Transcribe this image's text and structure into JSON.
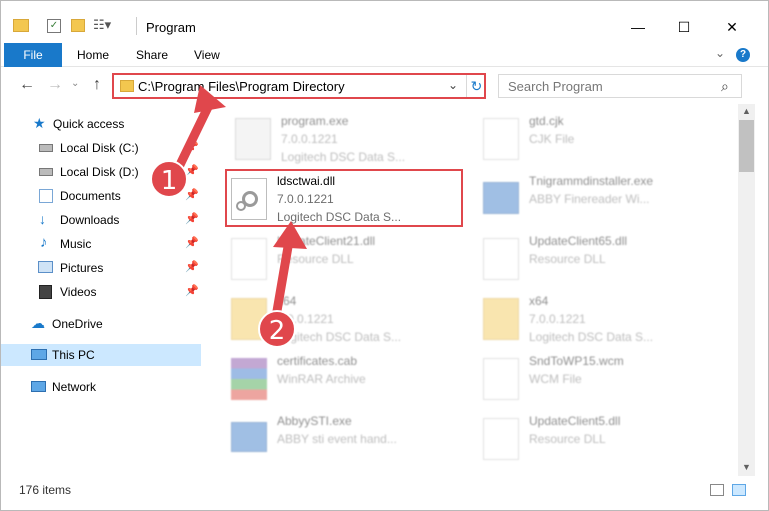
{
  "window": {
    "title": "Program",
    "minimize_glyph": "—",
    "maximize_glyph": "☐",
    "close_glyph": "✕"
  },
  "ribbon": {
    "tabs": [
      "File",
      "Home",
      "Share",
      "View"
    ],
    "help_glyph": "?"
  },
  "address": {
    "path": "C:\\Program Files\\Program Directory",
    "search_placeholder": "Search Program"
  },
  "nav": {
    "items": [
      {
        "label": "Quick access",
        "icon": "star-icon",
        "pinned": false
      },
      {
        "label": "Local Disk (C:)",
        "icon": "drive-icon",
        "pinned": true
      },
      {
        "label": "Local Disk (D:)",
        "icon": "drive-icon",
        "pinned": true
      },
      {
        "label": "Documents",
        "icon": "documents-icon",
        "pinned": true
      },
      {
        "label": "Downloads",
        "icon": "download-icon",
        "pinned": true
      },
      {
        "label": "Music",
        "icon": "music-icon",
        "pinned": true
      },
      {
        "label": "Pictures",
        "icon": "pictures-icon",
        "pinned": true
      },
      {
        "label": "Videos",
        "icon": "videos-icon",
        "pinned": true
      },
      {
        "label": "OneDrive",
        "icon": "cloud-icon",
        "pinned": false
      },
      {
        "label": "This PC",
        "icon": "pc-icon",
        "pinned": false,
        "selected": true
      },
      {
        "label": "Network",
        "icon": "network-icon",
        "pinned": false
      }
    ]
  },
  "files": [
    {
      "name": "program.exe",
      "version": "7.0.0.1221",
      "desc": "Logitech DSC Data S...",
      "icon": "exe-icon"
    },
    {
      "name": "gtd.cjk",
      "version": "CJK File",
      "desc": "",
      "icon": "doc-icon"
    },
    {
      "name": "ldsctwai.dll",
      "version": "7.0.0.1221",
      "desc": "Logitech DSC Data S...",
      "icon": "dll-icon",
      "highlight": true
    },
    {
      "name": "Tnigrammdinstaller.exe",
      "version": "ABBY Finereader Wi...",
      "desc": "",
      "icon": "installer-icon"
    },
    {
      "name": "UpdateClient21.dll",
      "version": "Resource DLL",
      "desc": "",
      "icon": "dll-icon"
    },
    {
      "name": "UpdateClient65.dll",
      "version": "Resource DLL",
      "desc": "",
      "icon": "dll-icon"
    },
    {
      "name": "x64",
      "version": "7.0.0.1221",
      "desc": "Logitech DSC Data S...",
      "icon": "folder-icon"
    },
    {
      "name": "x64",
      "version": "7.0.0.1221",
      "desc": "Logitech DSC Data S...",
      "icon": "folder-icon"
    },
    {
      "name": "certificates.cab",
      "version": "WinRAR Archive",
      "desc": "",
      "icon": "rar-icon"
    },
    {
      "name": "SndToWP15.wcm",
      "version": "WCM File",
      "desc": "",
      "icon": "doc-icon"
    },
    {
      "name": "AbbyySTI.exe",
      "version": "ABBY sti event hand...",
      "desc": "",
      "icon": "exe-icon"
    },
    {
      "name": "UpdateClient5.dll",
      "version": "Resource DLL",
      "desc": "",
      "icon": "dll-icon"
    }
  ],
  "status": {
    "item_count": "176 items"
  },
  "callouts": [
    "1",
    "2"
  ],
  "colors": {
    "accent": "#1979ca",
    "highlight_red": "#e0474c",
    "selected_bg": "#cce8ff"
  }
}
